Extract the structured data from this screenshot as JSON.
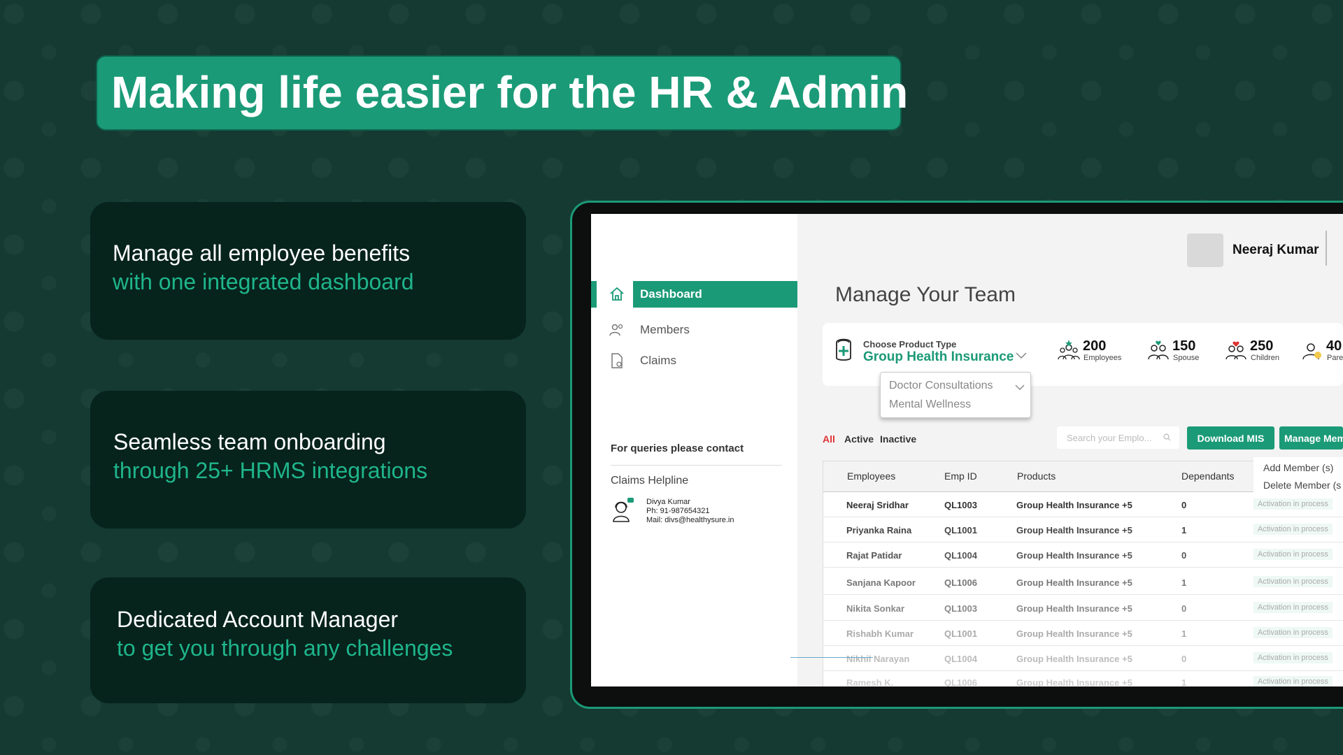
{
  "headline": "Making life easier for the HR & Admin",
  "features": [
    {
      "line1": "Manage all employee benefits",
      "line2": "with one integrated dashboard"
    },
    {
      "line1": "Seamless team onboarding",
      "line2": "through 25+ HRMS integrations"
    },
    {
      "line1": "Dedicated Account Manager",
      "line2": "to get you through any challenges"
    }
  ],
  "app": {
    "user": {
      "name": "Neeraj Kumar"
    },
    "sidebar": {
      "items": [
        {
          "label": "Dashboard",
          "icon": "home-icon",
          "active": true
        },
        {
          "label": "Members",
          "icon": "members-icon"
        },
        {
          "label": "Claims",
          "icon": "claims-icon"
        }
      ],
      "contact": {
        "heading": "For queries please contact",
        "helpline": "Claims Helpline",
        "name": "Divya Kumar",
        "phone": "Ph: 91-987654321",
        "mail": "Mail: divs@healthysure.in"
      }
    },
    "main": {
      "title": "Manage Your Team",
      "product": {
        "label": "Choose Product Type",
        "value": "Group Health Insurance",
        "options": [
          "Doctor Consultations",
          "Mental Wellness"
        ]
      },
      "stats": [
        {
          "value": "200",
          "label": "Employees"
        },
        {
          "value": "150",
          "label": "Spouse"
        },
        {
          "value": "250",
          "label": "Children"
        },
        {
          "value": "40",
          "label": "Pare"
        }
      ],
      "filters": [
        "All",
        "Active",
        "Inactive"
      ],
      "search_placeholder": "Search your Emplo...",
      "buttons": {
        "download": "Download MIS",
        "manage": "Manage Mem"
      },
      "manage_menu": [
        "Add Member (s)",
        "Delete Member (s"
      ],
      "table": {
        "columns": [
          "Employees",
          "Emp ID",
          "Products",
          "Dependants"
        ],
        "rows": [
          {
            "name": "Neeraj Sridhar",
            "id": "QL1003",
            "product": "Group Health Insurance +5",
            "dependants": "0",
            "status": "Activation in process"
          },
          {
            "name": "Priyanka Raina",
            "id": "QL1001",
            "product": "Group Health Insurance +5",
            "dependants": "1",
            "status": "Activation in process"
          },
          {
            "name": "Rajat Patidar",
            "id": "QL1004",
            "product": "Group Health Insurance +5",
            "dependants": "0",
            "status": "Activation in process"
          },
          {
            "name": "Sanjana Kapoor",
            "id": "QL1006",
            "product": "Group Health Insurance +5",
            "dependants": "1",
            "status": "Activation in process"
          },
          {
            "name": "Nikita Sonkar",
            "id": "QL1003",
            "product": "Group Health Insurance +5",
            "dependants": "0",
            "status": "Activation in process"
          },
          {
            "name": "Rishabh Kumar",
            "id": "QL1001",
            "product": "Group Health Insurance +5",
            "dependants": "1",
            "status": "Activation in process"
          },
          {
            "name": "Nikhil Narayan",
            "id": "QL1004",
            "product": "Group Health Insurance +5",
            "dependants": "0",
            "status": "Activation in process"
          },
          {
            "name": "Ramesh K.",
            "id": "QL1006",
            "product": "Group Health Insurance +5",
            "dependants": "1",
            "status": "Activation in process"
          }
        ]
      }
    }
  },
  "colors": {
    "brand": "#1b9a77",
    "background": "#143a31",
    "card": "#06231c",
    "accent_text": "#1fb58b",
    "filter_active": "#e03131"
  }
}
